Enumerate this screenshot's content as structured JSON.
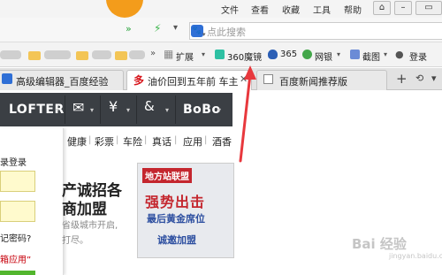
{
  "menubar": {
    "items": [
      "文件",
      "查看",
      "收藏",
      "工具",
      "帮助"
    ]
  },
  "search": {
    "placeholder": "点此搜索"
  },
  "toolbar": {
    "items": [
      "扩展",
      "360魔镜",
      "365",
      "网银",
      "截图",
      "登录"
    ]
  },
  "tabs": [
    {
      "title": "高级编辑器_百度经验"
    },
    {
      "title": "油价回到五年前 车主"
    },
    {
      "title": "百度新闻推荐版"
    }
  ],
  "lofter_bar": {
    "items": [
      "LOFTER",
      "BoBo"
    ]
  },
  "nav": {
    "links": [
      "健康",
      "彩票",
      "车险",
      "真话",
      "应用",
      "酒香"
    ]
  },
  "login": {
    "title": "录登录",
    "forgot": "记密码?",
    "app_link": "箱应用”"
  },
  "main": {
    "headline1": "产诚招各",
    "headline2": "商加盟",
    "desc1": "省级城市开启,",
    "desc2": "打尽。"
  },
  "ad": {
    "tag": "地方站联盟",
    "line1": "强势出击",
    "line2": "最后黄金席位",
    "line3": "诚邀加盟"
  },
  "watermark": {
    "text": "Bai 经验",
    "sub": "jingyan.baidu.com"
  },
  "colors": {
    "accent": "#f39c1b",
    "dark_bar": "#3b3f44",
    "arrow": "#e8383d"
  }
}
